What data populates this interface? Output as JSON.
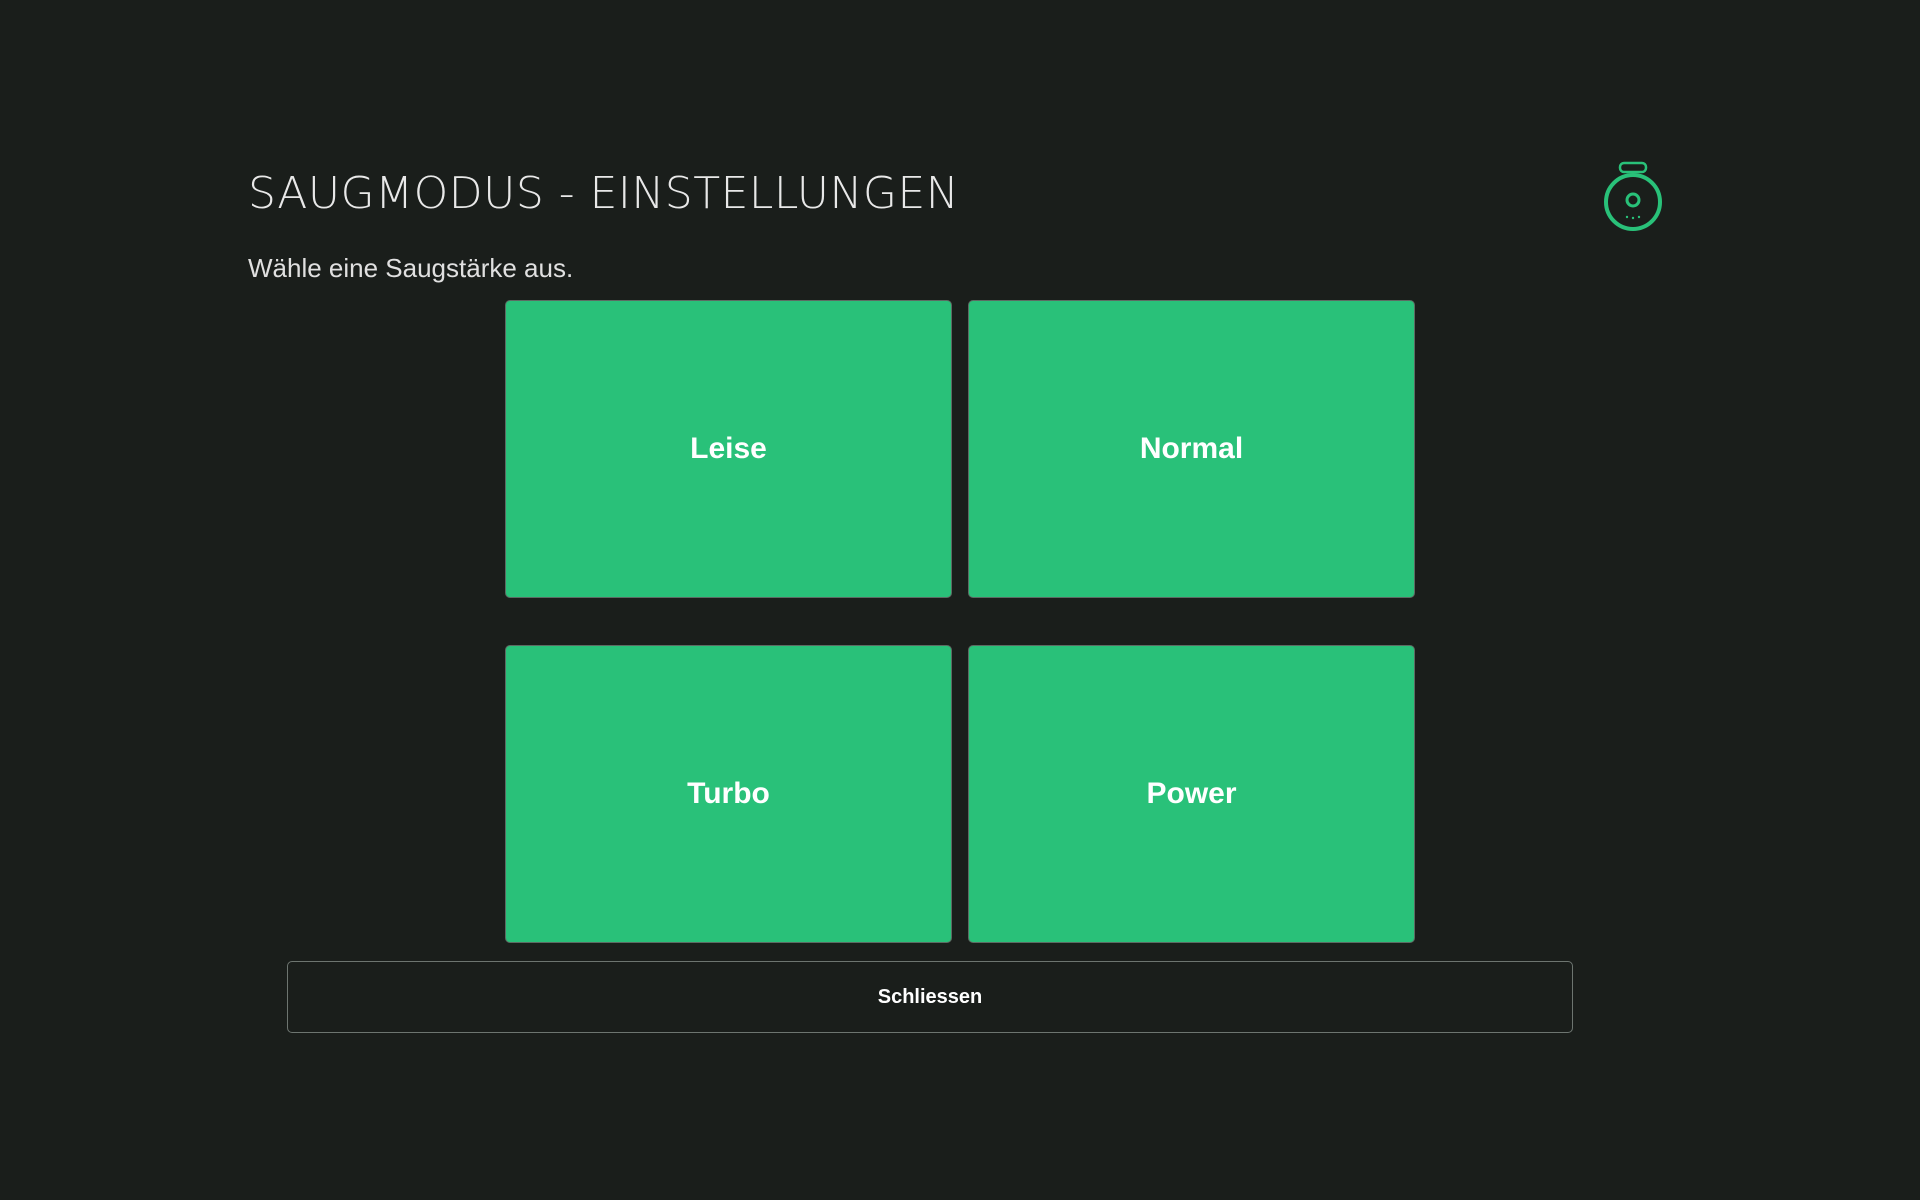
{
  "header": {
    "title": "SAUGMODUS - EINSTELLUNGEN",
    "subtitle": "Wähle eine Saugstärke aus.",
    "icon": "robot-vacuum-icon"
  },
  "modes": [
    {
      "label": "Leise"
    },
    {
      "label": "Normal"
    },
    {
      "label": "Turbo"
    },
    {
      "label": "Power"
    }
  ],
  "footer": {
    "close_label": "Schliessen"
  },
  "colors": {
    "background": "#1a1e1b",
    "accent": "#29c179",
    "text": "#e8e8e8"
  }
}
